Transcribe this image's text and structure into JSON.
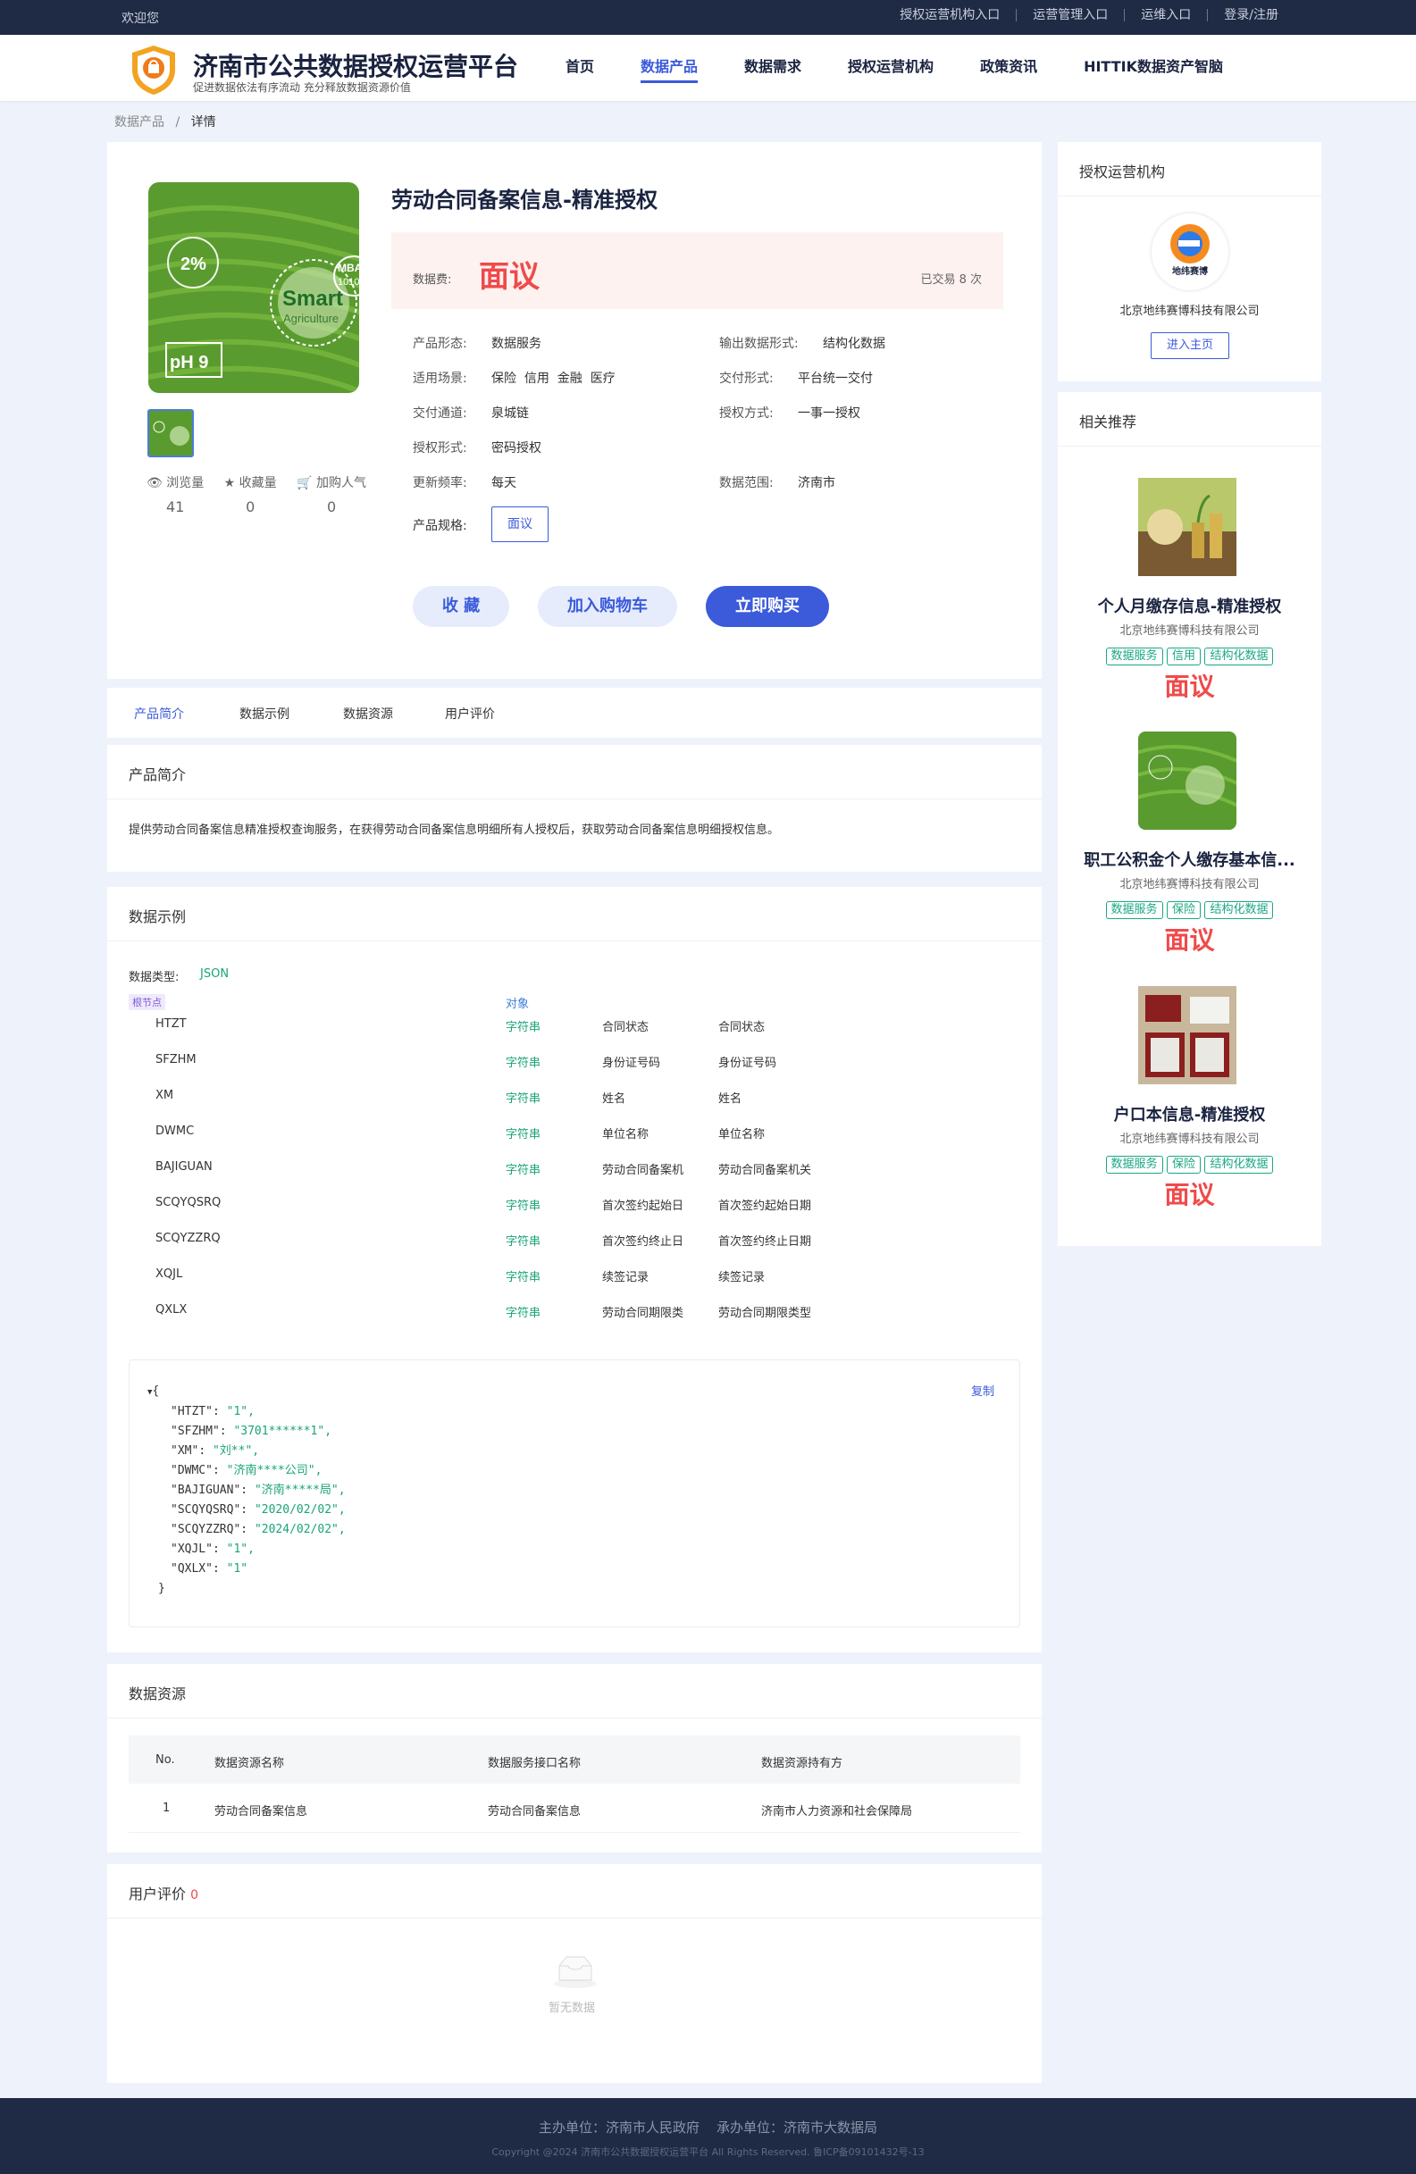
{
  "topbar": {
    "welcome": "欢迎您",
    "links": [
      "授权运营机构入口",
      "运营管理入口",
      "运维入口",
      "登录/注册"
    ]
  },
  "header": {
    "title": "济南市公共数据授权运营平台",
    "subtitle": "促进数据依法有序流动 充分释放数据资源价值",
    "nav": [
      "首页",
      "数据产品",
      "数据需求",
      "授权运营机构",
      "政策资讯",
      "HITTIK数据资产智脑"
    ],
    "active_nav": "数据产品"
  },
  "breadcrumb": {
    "parent": "数据产品",
    "sep": "/",
    "current": "详情"
  },
  "product": {
    "title": "劳动合同备案信息-精准授权",
    "image_text": {
      "percent": "2%",
      "smart": "Smart",
      "agri": "Agriculture",
      "ph": "pH 9",
      "mba": "MBA",
      "mba_num": "1010"
    },
    "fee_label": "数据费:",
    "fee_value": "面议",
    "trade_count": "已交易 8 次",
    "fields": [
      {
        "k": "产品形态:",
        "v": "数据服务"
      },
      {
        "k": "输出数据形式:",
        "v": "结构化数据"
      },
      {
        "k": "适用场景:",
        "v": "保险  信用  金融  医疗"
      },
      {
        "k": "交付形式:",
        "v": "平台统一交付"
      },
      {
        "k": "交付通道:",
        "v": "泉城链"
      },
      {
        "k": "授权方式:",
        "v": "一事一授权"
      },
      {
        "k": "授权形式:",
        "v": "密码授权"
      },
      {
        "k": "更新频率:",
        "v": "每天"
      },
      {
        "k": "数据范围:",
        "v": "济南市"
      }
    ],
    "spec_label": "产品规格:",
    "spec_value": "面议",
    "stats": [
      {
        "label": "浏览量",
        "value": "41"
      },
      {
        "label": "收藏量",
        "value": "0"
      },
      {
        "label": "加购人气",
        "value": "0"
      }
    ],
    "buttons": {
      "fav": "收 藏",
      "cart": "加入购物车",
      "buy": "立即购买"
    }
  },
  "tabs": [
    "产品简介",
    "数据示例",
    "数据资源",
    "用户评价"
  ],
  "intro": {
    "title": "产品简介",
    "text": "提供劳动合同备案信息精准授权查询服务，在获得劳动合同备案信息明细所有人授权后，获取劳动合同备案信息明细授权信息。"
  },
  "example": {
    "title": "数据示例",
    "type_label": "数据类型:",
    "type_value": "JSON",
    "root_tag": "根节点",
    "root_type": "对象",
    "fields": [
      {
        "name": "HTZT",
        "type": "字符串",
        "desc": "合同状态",
        "desc2": "合同状态"
      },
      {
        "name": "SFZHM",
        "type": "字符串",
        "desc": "身份证号码",
        "desc2": "身份证号码"
      },
      {
        "name": "XM",
        "type": "字符串",
        "desc": "姓名",
        "desc2": "姓名"
      },
      {
        "name": "DWMC",
        "type": "字符串",
        "desc": "单位名称",
        "desc2": "单位名称"
      },
      {
        "name": "BAJIGUAN",
        "type": "字符串",
        "desc": "劳动合同备案机",
        "desc2": "劳动合同备案机关"
      },
      {
        "name": "SCQYQSRQ",
        "type": "字符串",
        "desc": "首次签约起始日",
        "desc2": "首次签约起始日期"
      },
      {
        "name": "SCQYZZRQ",
        "type": "字符串",
        "desc": "首次签约终止日",
        "desc2": "首次签约终止日期"
      },
      {
        "name": "XQJL",
        "type": "字符串",
        "desc": "续签记录",
        "desc2": "续签记录"
      },
      {
        "name": "QXLX",
        "type": "字符串",
        "desc": "劳动合同期限类",
        "desc2": "劳动合同期限类型"
      }
    ],
    "copy": "复制",
    "json": [
      {
        "k": "\"HTZT\"",
        "v": "\"1\","
      },
      {
        "k": "\"SFZHM\"",
        "v": "\"3701******1\","
      },
      {
        "k": "\"XM\"",
        "v": "\"刘**\","
      },
      {
        "k": "\"DWMC\"",
        "v": "\"济南****公司\","
      },
      {
        "k": "\"BAJIGUAN\"",
        "v": "\"济南*****局\","
      },
      {
        "k": "\"SCQYQSRQ\"",
        "v": "\"2020/02/02\","
      },
      {
        "k": "\"SCQYZZRQ\"",
        "v": "\"2024/02/02\","
      },
      {
        "k": "\"XQJL\"",
        "v": "\"1\","
      },
      {
        "k": "\"QXLX\"",
        "v": "\"1\""
      }
    ]
  },
  "resources": {
    "title": "数据资源",
    "headers": [
      "No.",
      "数据资源名称",
      "数据服务接口名称",
      "数据资源持有方"
    ],
    "rows": [
      [
        "1",
        "劳动合同备案信息",
        "劳动合同备案信息",
        "济南市人力资源和社会保障局"
      ]
    ]
  },
  "reviews": {
    "title": "用户评价",
    "count": "0",
    "empty": "暂无数据"
  },
  "org": {
    "title": "授权运营机构",
    "logo_text": "地纬赛博",
    "name": "北京地纬赛博科技有限公司",
    "button": "进入主页"
  },
  "related": {
    "title": "相关推荐",
    "items": [
      {
        "title": "个人月缴存信息-精准授权",
        "company": "北京地纬赛博科技有限公司",
        "tags": [
          "数据服务",
          "信用",
          "结构化数据"
        ],
        "price": "面议"
      },
      {
        "title": "职工公积金个人缴存基本信...",
        "company": "北京地纬赛博科技有限公司",
        "tags": [
          "数据服务",
          "保险",
          "结构化数据"
        ],
        "price": "面议"
      },
      {
        "title": "户口本信息-精准授权",
        "company": "北京地纬赛博科技有限公司",
        "tags": [
          "数据服务",
          "保险",
          "结构化数据"
        ],
        "price": "面议"
      }
    ]
  },
  "footer": {
    "line1": "主办单位：济南市人民政府    承办单位：济南市大数据局",
    "line2": "Copyright @2024 济南市公共数据授权运营平台 All Rights Reserved. 鲁ICP备09101432号-13"
  },
  "colors": {
    "navy": "#1f2a44",
    "primary": "#3b5bdb",
    "price": "#f04a4a",
    "green": "#1aa37a"
  }
}
